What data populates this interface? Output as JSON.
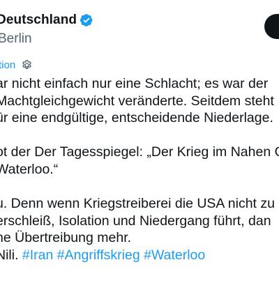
{
  "author": {
    "display_name": "Deutschland",
    "handle": "Berlin"
  },
  "translation": {
    "label": "tion"
  },
  "tweet": {
    "lines": [
      "ar nicht einfach nur eine Schlacht; es war der",
      "Machtgleichgewicht veränderte. Seitdem steht",
      "ür eine endgültige, entscheidende Niederlage.",
      "ot der Der Tagesspiegel: „Der Krieg im Nahen O",
      "Waterloo.“",
      "u. Denn wenn Kriegstreiberei die USA nicht zu",
      "erschleiß, Isolation und Niedergang führt, dan",
      "ne Übertreibung mehr."
    ],
    "last_line_prefix": "Nili. ",
    "hashtags": [
      "#Iran",
      "#Angriffskrieg",
      "#Waterloo"
    ]
  },
  "colors": {
    "text": "#0f1419",
    "secondary": "#536471",
    "accent": "#1d9bf0"
  },
  "icons": {
    "verified": "verified-badge-icon",
    "settings": "gear-icon"
  }
}
